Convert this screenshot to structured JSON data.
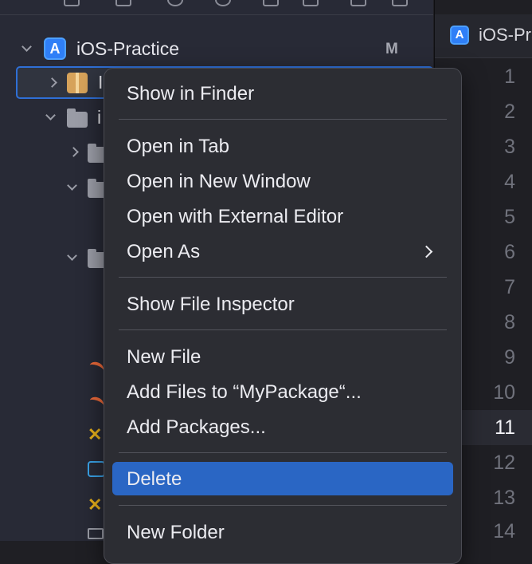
{
  "navigator": {
    "project_name": "iOS-Practice",
    "project_status": "M",
    "selected_item_partial": "I",
    "folder_item_partial": "i"
  },
  "editor": {
    "tab_label": "iOS-Pra",
    "line_numbers": [
      "1",
      "2",
      "3",
      "4",
      "5",
      "6",
      "7",
      "8",
      "9",
      "10",
      "11",
      "12",
      "13",
      "14"
    ],
    "current_line": "11"
  },
  "context_menu": {
    "show_in_finder": "Show in Finder",
    "open_in_tab": "Open in Tab",
    "open_in_new_window": "Open in New Window",
    "open_with_external_editor": "Open with External Editor",
    "open_as": "Open As",
    "show_file_inspector": "Show File Inspector",
    "new_file": "New File",
    "add_files": "Add Files to “MyPackage“...",
    "add_packages": "Add Packages...",
    "delete": "Delete",
    "new_folder": "New Folder"
  },
  "colors": {
    "highlight": "#2a66c4",
    "accent_blue": "#2f7ff7",
    "swift_orange": "#ef6a3a",
    "xcassets_yellow": "#e9b11a"
  }
}
